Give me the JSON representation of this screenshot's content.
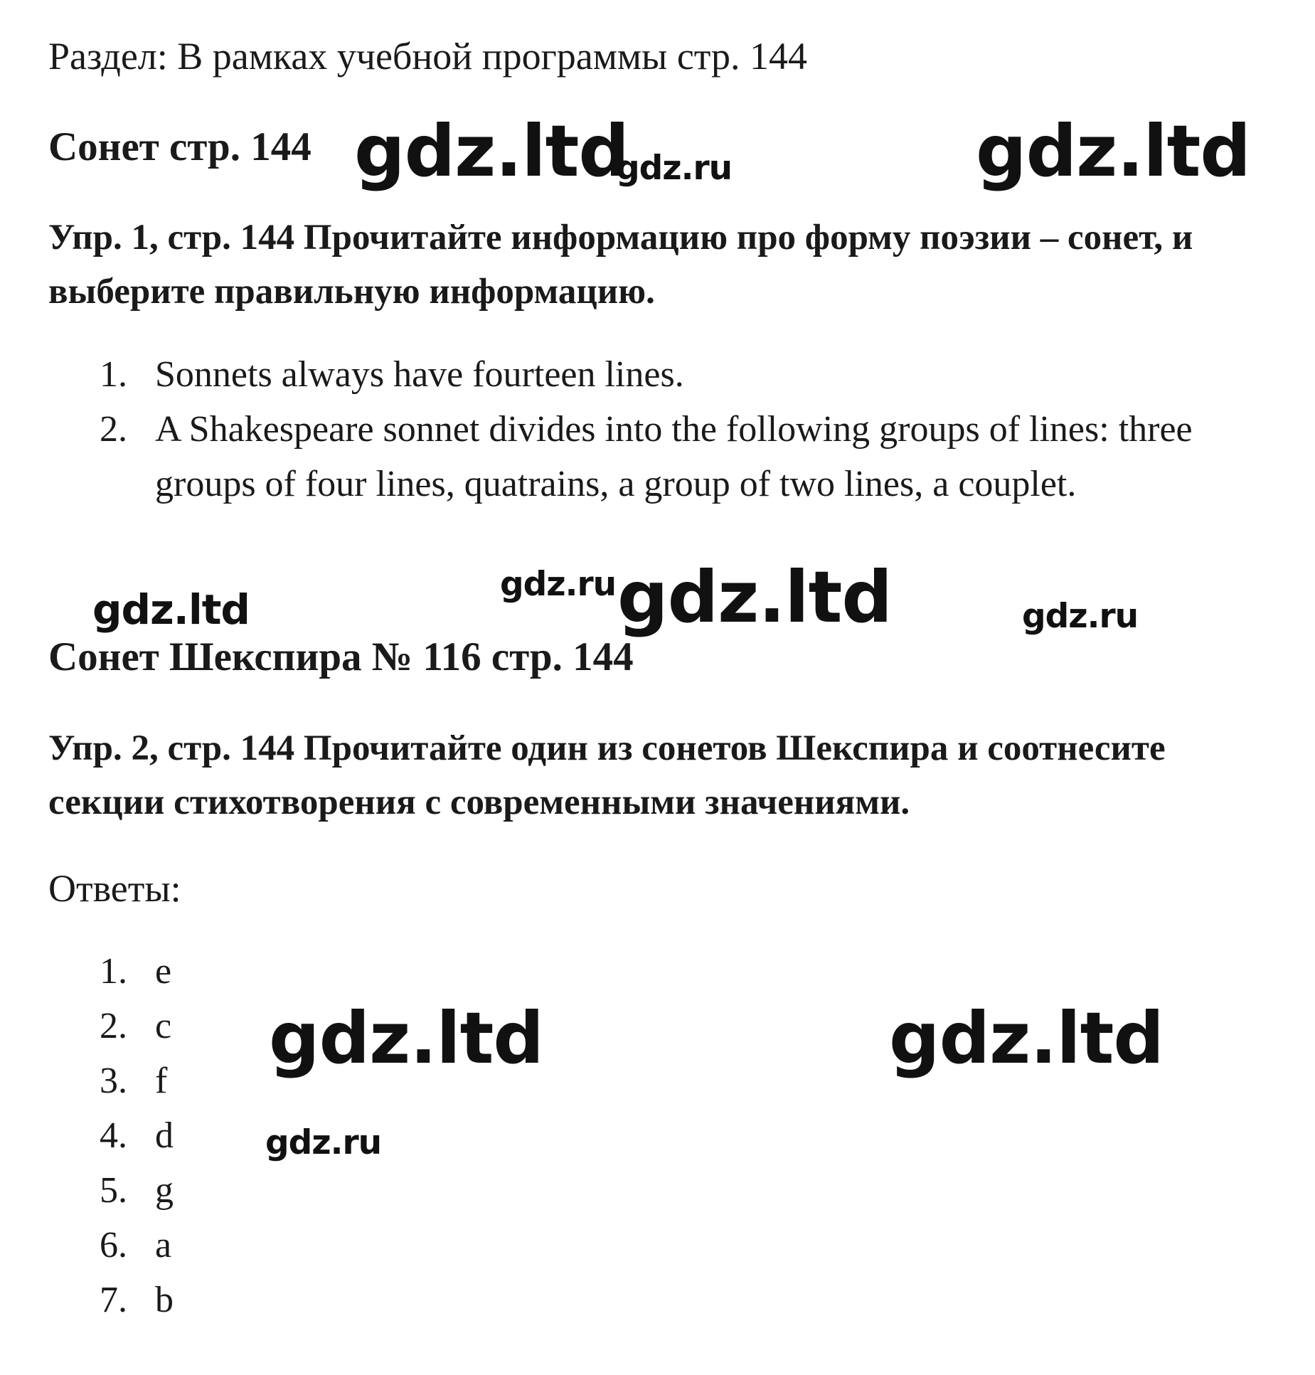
{
  "document": {
    "section_line": "Раздел: В рамках учебной программы стр. 144",
    "heading_sonnet": "Сонет стр. 144",
    "task_1": "Упр. 1, стр. 144 Прочитайте информацию про форму поэзии – сонет, и выберите правильную информацию.",
    "list_1": [
      {
        "num": "1.",
        "text": "Sonnets always have fourteen lines."
      },
      {
        "num": "2.",
        "text": "A Shakespeare sonnet divides into the following groups of lines: three groups of four lines, quatrains, a group of two lines, a couplet."
      }
    ],
    "heading_shakespeare": "Сонет Шекспира № 116 стр. 144",
    "task_2": "Упр. 2, стр. 144 Прочитайте один из сонетов Шекспира и соотнесите секции стихотворения с современными значениями.",
    "answers_label": "Ответы:",
    "answers": [
      {
        "num": "1.",
        "text": "e"
      },
      {
        "num": "2.",
        "text": "c"
      },
      {
        "num": "3.",
        "text": "f"
      },
      {
        "num": "4.",
        "text": "d"
      },
      {
        "num": "5.",
        "text": "g"
      },
      {
        "num": "6.",
        "text": "a"
      },
      {
        "num": "7.",
        "text": "b"
      }
    ]
  },
  "watermarks": {
    "ltd": "gdz.ltd",
    "ru": "gdz.ru"
  }
}
